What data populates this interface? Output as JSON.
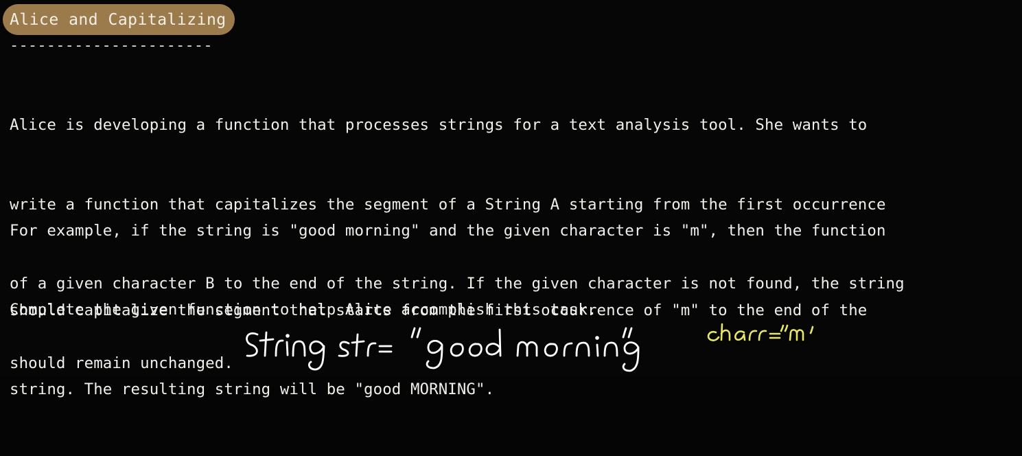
{
  "header": {
    "title": "Alice and Capitalizing",
    "rule": "----------------------"
  },
  "problem": {
    "paragraph_1": [
      "Alice is developing a function that processes strings for a text analysis tool. She wants to",
      "write a function that capitalizes the segment of a String A starting from the first occurrence",
      "of a given character B to the end of the string. If the given character is not found, the string",
      "should remain unchanged."
    ],
    "paragraph_2": [
      "For example, if the string is \"good morning\" and the given character is \"m\", then the function",
      "should capitalize the segment that starts from the first occurrence of \"m\" to the end of the",
      "string. The resulting string will be \"good MORNING\"."
    ],
    "paragraph_3": [
      "Complete the given function to help Alice accomplish this task."
    ]
  },
  "handwritten_notes": {
    "string_note": "String str= \"good morning\"",
    "char_note": "char=\"m'",
    "string_note_color": "#ffffff",
    "char_note_color": "#e7e66a"
  }
}
